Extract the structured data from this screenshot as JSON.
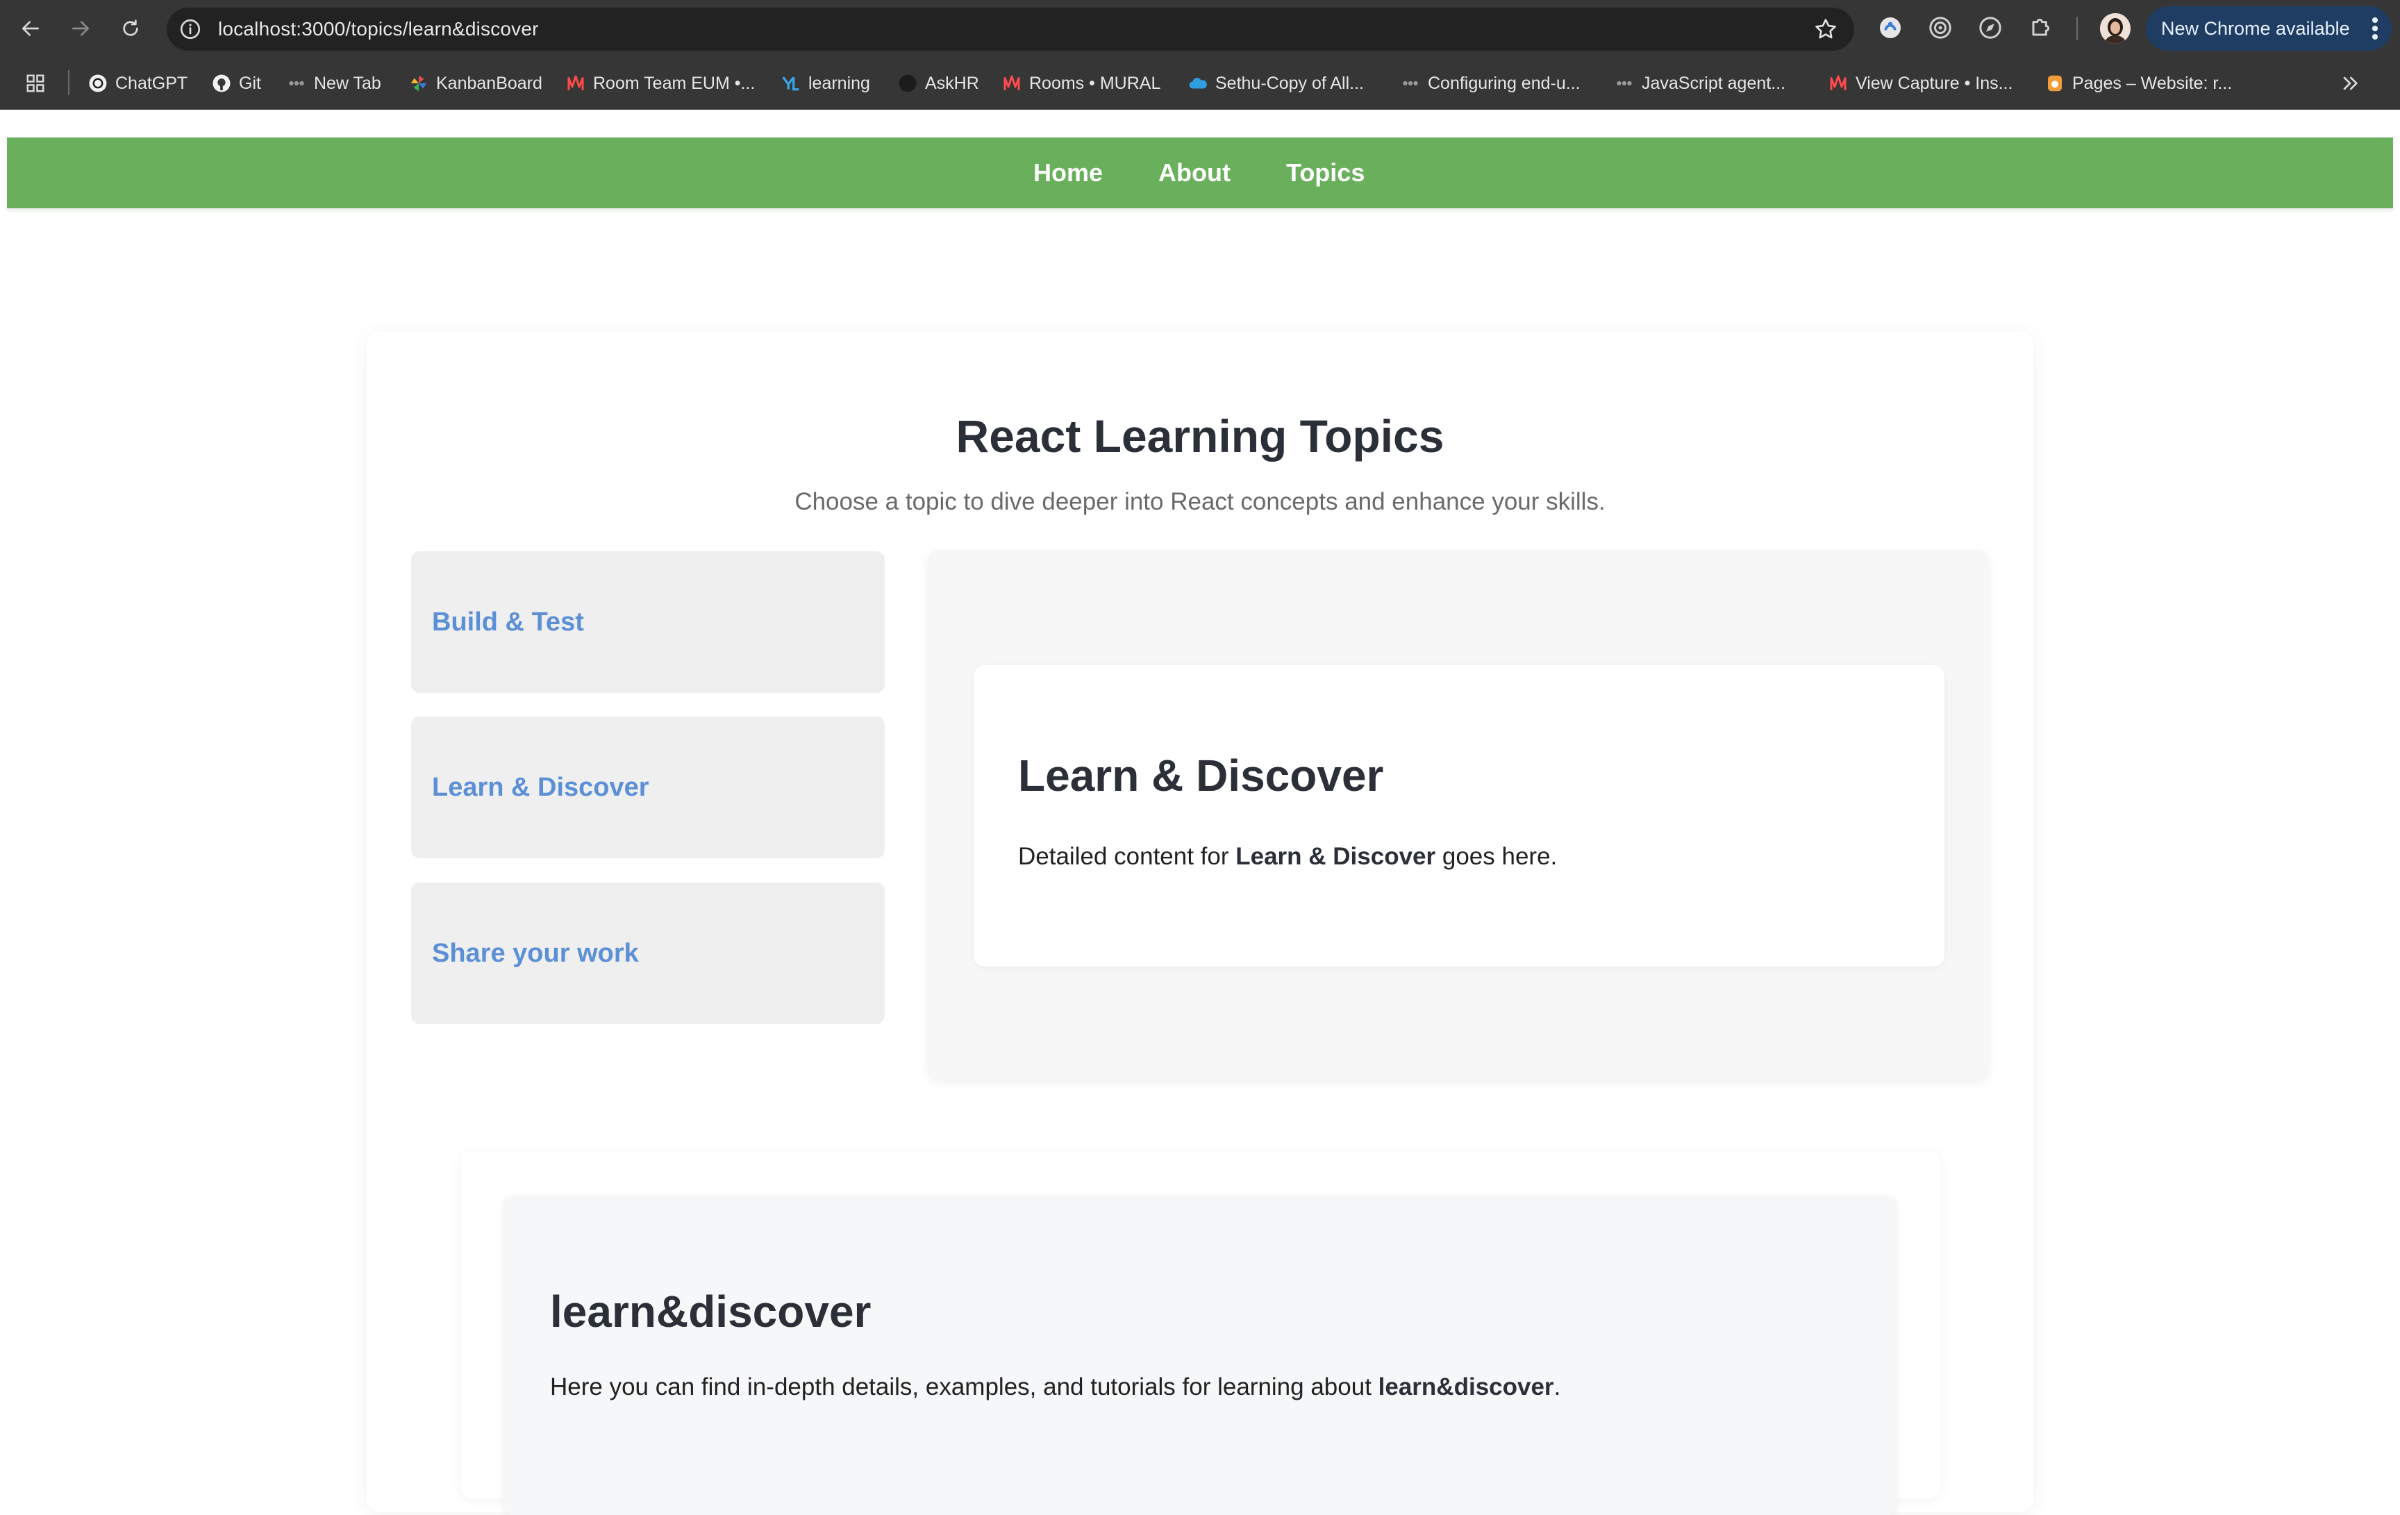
{
  "browser": {
    "url": "localhost:3000/topics/learn&discover",
    "update_label": "New Chrome available",
    "bookmarks": [
      {
        "label": "ChatGPT",
        "icon": "chatgpt-icon"
      },
      {
        "label": "Git",
        "icon": "github-icon"
      },
      {
        "label": "New Tab",
        "icon": "dots-icon"
      },
      {
        "label": "KanbanBoard",
        "icon": "pinwheel-icon"
      },
      {
        "label": "Room Team EUM •...",
        "icon": "mural-icon"
      },
      {
        "label": "learning",
        "icon": "yellowpage-icon"
      },
      {
        "label": "AskHR",
        "icon": "circle-icon"
      },
      {
        "label": "Rooms • MURAL",
        "icon": "mural-icon"
      },
      {
        "label": "Sethu-Copy of All...",
        "icon": "cloud-icon"
      },
      {
        "label": "Configuring end-u...",
        "icon": "dots-icon"
      },
      {
        "label": "JavaScript agent...",
        "icon": "dots-icon"
      },
      {
        "label": "View Capture • Ins...",
        "icon": "mural-icon"
      },
      {
        "label": "Pages – Website: r...",
        "icon": "badge-icon"
      }
    ]
  },
  "site": {
    "nav": {
      "home": "Home",
      "about": "About",
      "topics": "Topics"
    },
    "brand_color": "#6ab05c",
    "link_color": "#5b8fd6"
  },
  "main": {
    "title": "React Learning Topics",
    "subtitle": "Choose a topic to dive deeper into React concepts and enhance your skills.",
    "topics": [
      {
        "label": "Build & Test"
      },
      {
        "label": "Learn & Discover"
      },
      {
        "label": "Share your work"
      }
    ],
    "detail": {
      "title": "Learn & Discover",
      "body_prefix": "Detailed content for ",
      "body_bold": "Learn & Discover",
      "body_suffix": " goes here."
    },
    "topic_page": {
      "title": "learn&discover",
      "body_prefix": "Here you can find in-depth details, examples, and tutorials for learning about ",
      "body_bold": "learn&discover",
      "body_suffix": "."
    }
  }
}
